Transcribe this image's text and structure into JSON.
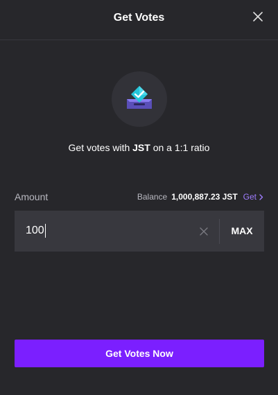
{
  "header": {
    "title": "Get Votes"
  },
  "hero": {
    "icon": "ballot-box-icon",
    "tagline_prefix": "Get votes with ",
    "tagline_token": "JST",
    "tagline_suffix": " on a 1:1 ratio"
  },
  "form": {
    "amount_label": "Amount",
    "balance_label": "Balance",
    "balance_value": "1,000,887.23 JST",
    "get_link_label": "Get",
    "amount_value": "100",
    "max_label": "MAX"
  },
  "cta": {
    "label": "Get Votes Now"
  },
  "colors": {
    "background": "#27272b",
    "input_background": "#38383e",
    "accent": "#7b1fff",
    "link": "#9f7dff",
    "icon_teal": "#26c6da"
  }
}
